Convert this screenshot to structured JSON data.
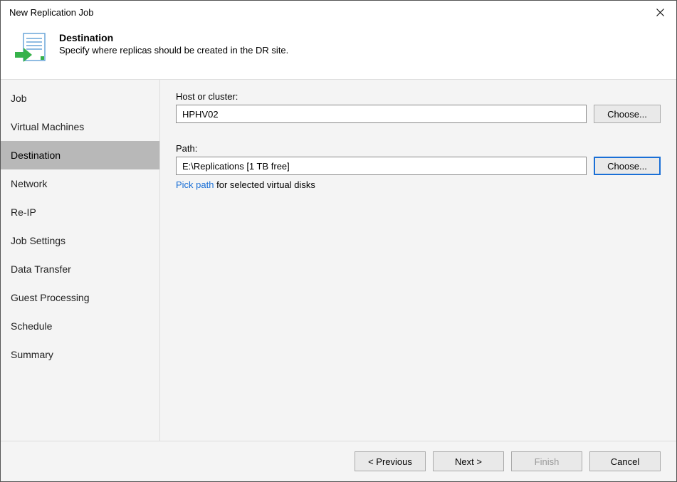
{
  "window": {
    "title": "New Replication Job"
  },
  "header": {
    "title": "Destination",
    "description": "Specify where replicas should be created in the DR site."
  },
  "sidebar": {
    "items": [
      {
        "label": "Job",
        "active": false
      },
      {
        "label": "Virtual Machines",
        "active": false
      },
      {
        "label": "Destination",
        "active": true
      },
      {
        "label": "Network",
        "active": false
      },
      {
        "label": "Re-IP",
        "active": false
      },
      {
        "label": "Job Settings",
        "active": false
      },
      {
        "label": "Data Transfer",
        "active": false
      },
      {
        "label": "Guest Processing",
        "active": false
      },
      {
        "label": "Schedule",
        "active": false
      },
      {
        "label": "Summary",
        "active": false
      }
    ]
  },
  "main": {
    "host": {
      "label": "Host or cluster:",
      "value": "HPHV02",
      "choose": "Choose..."
    },
    "path": {
      "label": "Path:",
      "value": "E:\\Replications [1 TB free]",
      "choose": "Choose...",
      "pick_link": "Pick path",
      "pick_suffix": "  for selected virtual disks"
    }
  },
  "footer": {
    "previous": "< Previous",
    "next": "Next >",
    "finish": "Finish",
    "cancel": "Cancel"
  }
}
